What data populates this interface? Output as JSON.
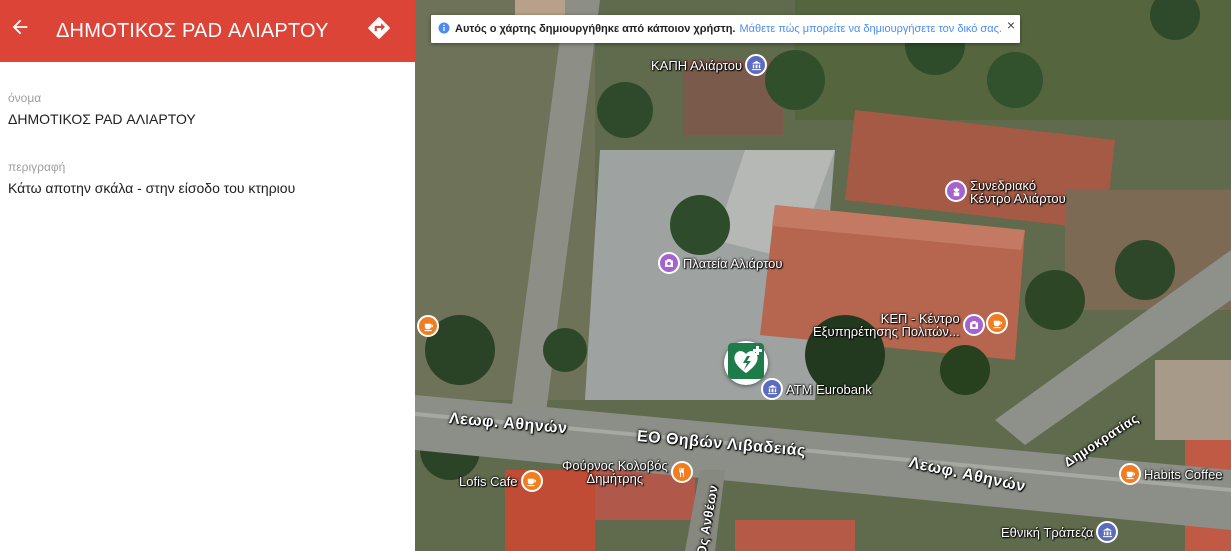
{
  "header": {
    "title": "ΔΗΜΟΤΙΚΟΣ PAD ΑΛΙΑΡΤΟΥ",
    "back_icon": "arrow-back-icon",
    "directions_icon": "directions-icon"
  },
  "fields": {
    "name_label": "όνομα",
    "name_value": "ΔΗΜΟΤΙΚΟΣ PAD ΑΛΙΑΡΤΟΥ",
    "description_label": "περιγραφή",
    "description_value": "Κάτω αποτην σκάλα - στην είσοδο του κτηριου"
  },
  "notice": {
    "text": "Αυτός ο χάρτης δημιουργήθηκε από κάποιον χρήστη.",
    "link": "Μάθετε πώς μπορείτε να δημιουργήσετε τον δικό σας.",
    "close": "×"
  },
  "map": {
    "pois": {
      "kapi": "ΚΑΠΗ Αλιάρτου",
      "congress_1": "Συνεδριακό",
      "congress_2": "Κέντρο Αλιάρτου",
      "square": "Πλατεία Αλιάρτου",
      "kep_1": "ΚΕΠ - Κέντρο",
      "kep_2": "Εξυπηρέτησης Πολιτών...",
      "atm": "ATM Eurobank",
      "bakery_1": "Φούρνος Κολοβός",
      "bakery_2": "Δημήτρης",
      "lofis": "Lofis Cafe",
      "habits": "Habits Coffee",
      "bank": "Εθνική Τράπεζα"
    },
    "roads": {
      "athinon_west": "Λεωφ. Αθηνών",
      "eo": "ΕΟ Θηβών Λιβαδειάς",
      "athinon_east": "Λεωφ. Αθηνών",
      "dimokratias": "Δημοκρατίας",
      "anthewn": "Ος Ανθέων"
    },
    "colors": {
      "attraction": "#a463cf",
      "cafe": "#f07e21",
      "food": "#f07e21",
      "bank": "#5c6bc0",
      "aed": "#1e7c4a"
    }
  }
}
